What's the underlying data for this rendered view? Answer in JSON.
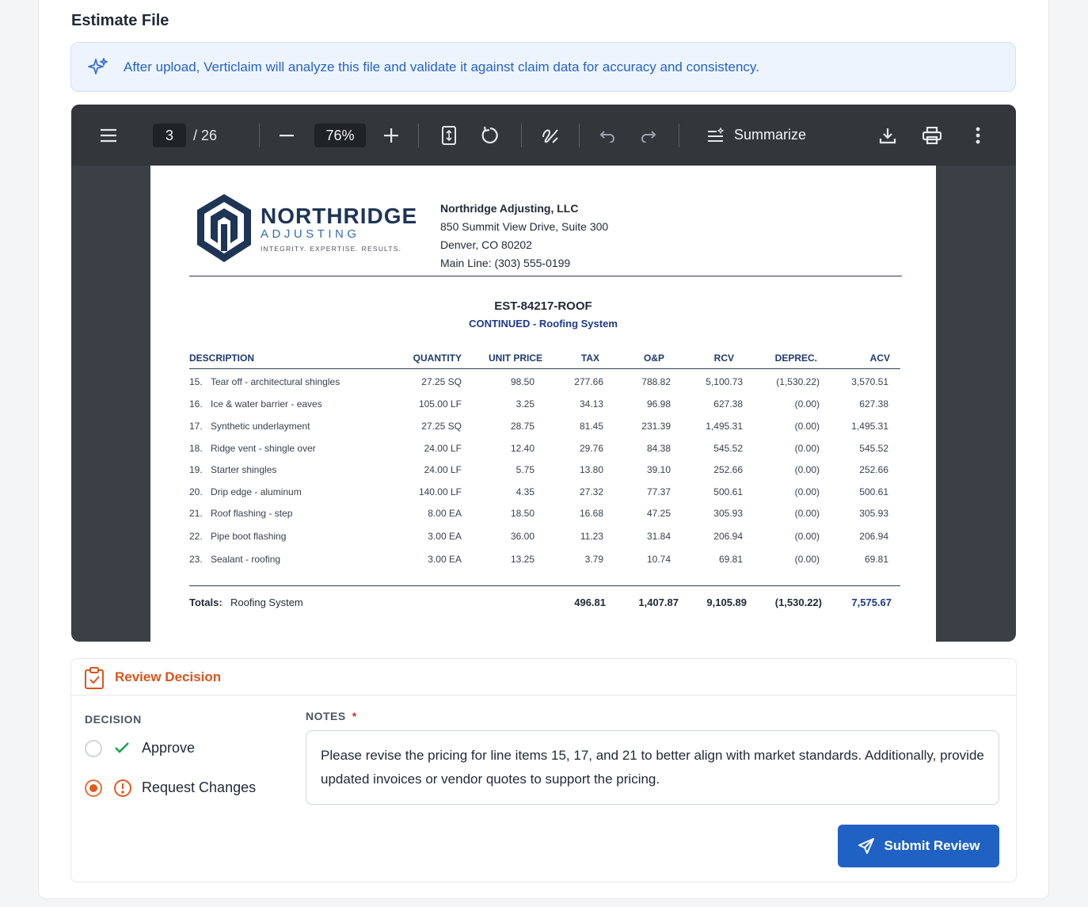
{
  "section_title": "Estimate File",
  "banner": {
    "icon": "sparkles-icon",
    "text": "After upload, Verticlaim will analyze this file and validate it against claim data for accuracy and consistency."
  },
  "viewer": {
    "toolbar": {
      "current_page": "3",
      "total_pages": "/ 26",
      "zoom": "76%",
      "summarize_label": "Summarize"
    },
    "document": {
      "brand_name": "NORTHRIDGE",
      "brand_sub": "ADJUSTING",
      "brand_tagline": "INTEGRITY. EXPERTISE. RESULTS.",
      "company_name": "Northridge Adjusting, LLC",
      "address_line1": "850 Summit View Drive, Suite 300",
      "address_line2": "Denver, CO 80202",
      "phone": "Main Line:  (303) 555-0199",
      "estimate_id": "EST-84217-ROOF",
      "estimate_sub": "CONTINUED - Roofing System",
      "columns": [
        "DESCRIPTION",
        "QUANTITY",
        "UNIT PRICE",
        "TAX",
        "O&P",
        "RCV",
        "DEPREC.",
        "ACV"
      ],
      "rows": [
        {
          "num": "15.",
          "desc": "Tear off - architectural shingles",
          "qty": "27.25 SQ",
          "unit": "98.50",
          "tax": "277.66",
          "op": "788.82",
          "rcv": "5,100.73",
          "dep": "(1,530.22)",
          "acv": "3,570.51"
        },
        {
          "num": "16.",
          "desc": "Ice & water barrier - eaves",
          "qty": "105.00 LF",
          "unit": "3.25",
          "tax": "34.13",
          "op": "96.98",
          "rcv": "627.38",
          "dep": "(0.00)",
          "acv": "627.38"
        },
        {
          "num": "17.",
          "desc": "Synthetic underlayment",
          "qty": "27.25 SQ",
          "unit": "28.75",
          "tax": "81.45",
          "op": "231.39",
          "rcv": "1,495.31",
          "dep": "(0.00)",
          "acv": "1,495.31"
        },
        {
          "num": "18.",
          "desc": "Ridge vent - shingle over",
          "qty": "24.00 LF",
          "unit": "12.40",
          "tax": "29.76",
          "op": "84.38",
          "rcv": "545.52",
          "dep": "(0.00)",
          "acv": "545.52"
        },
        {
          "num": "19.",
          "desc": "Starter shingles",
          "qty": "24.00 LF",
          "unit": "5.75",
          "tax": "13.80",
          "op": "39.10",
          "rcv": "252.66",
          "dep": "(0.00)",
          "acv": "252.66"
        },
        {
          "num": "20.",
          "desc": "Drip edge - aluminum",
          "qty": "140.00 LF",
          "unit": "4.35",
          "tax": "27.32",
          "op": "77.37",
          "rcv": "500.61",
          "dep": "(0.00)",
          "acv": "500.61"
        },
        {
          "num": "21.",
          "desc": "Roof flashing - step",
          "qty": "8.00 EA",
          "unit": "18.50",
          "tax": "16.68",
          "op": "47.25",
          "rcv": "305.93",
          "dep": "(0.00)",
          "acv": "305.93"
        },
        {
          "num": "22.",
          "desc": "Pipe boot flashing",
          "qty": "3.00 EA",
          "unit": "36.00",
          "tax": "11.23",
          "op": "31.84",
          "rcv": "206.94",
          "dep": "(0.00)",
          "acv": "206.94"
        },
        {
          "num": "23.",
          "desc": "Sealant - roofing",
          "qty": "3.00 EA",
          "unit": "13.25",
          "tax": "3.79",
          "op": "10.74",
          "rcv": "69.81",
          "dep": "(0.00)",
          "acv": "69.81"
        }
      ],
      "totals": {
        "label": "Totals:",
        "section": "Roofing System",
        "tax": "496.81",
        "op": "1,407.87",
        "rcv": "9,105.89",
        "dep": "(1,530.22)",
        "acv": "7,575.67"
      }
    }
  },
  "review": {
    "title": "Review Decision",
    "decision_label": "DECISION",
    "options": [
      {
        "label": "Approve",
        "selected": false,
        "icon": "check-icon"
      },
      {
        "label": "Request Changes",
        "selected": true,
        "icon": "alert-circle-icon"
      }
    ],
    "notes_label": "NOTES",
    "notes_required": "*",
    "notes_text": "Please revise the pricing for line items 15, 17, and 21 to better align with market standards. Additionally, provide updated invoices or vendor quotes to support the pricing.",
    "submit_label": "Submit Review"
  },
  "colors": {
    "accent_blue": "#1f62c4",
    "accent_orange": "#d9541e",
    "approve_green": "#16a34a",
    "navy": "#1e3556"
  }
}
